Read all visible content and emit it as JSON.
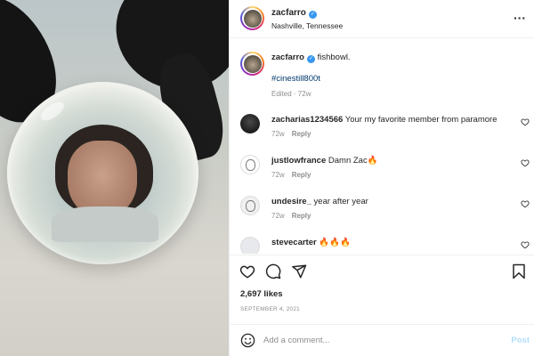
{
  "post": {
    "username": "zacfarro",
    "location": "Nashville, Tennessee",
    "more_icon": "more-horizontal-icon",
    "verified_icon": "verified-badge-icon"
  },
  "caption": {
    "username": "zacfarro",
    "text": "fishbowl.",
    "hashtag": "#cinestill800t",
    "meta": "Edited · 72w"
  },
  "comments": [
    {
      "username": "zacharias1234566",
      "text": "Your my favorite member from paramore",
      "age": "72w",
      "reply": "Reply"
    },
    {
      "username": "justlowfrance",
      "text": "Damn Zac🔥",
      "age": "72w",
      "reply": "Reply"
    },
    {
      "username": "undesire_",
      "text": "year after year",
      "age": "72w",
      "reply": "Reply"
    },
    {
      "username": "stevecarter",
      "text": "🔥🔥🔥",
      "age": "",
      "reply": ""
    }
  ],
  "actions": {
    "like_icon": "heart-icon",
    "comment_icon": "comment-icon",
    "share_icon": "paper-plane-icon",
    "save_icon": "bookmark-icon"
  },
  "likes": "2,697 likes",
  "date": "SEPTEMBER 4, 2021",
  "composer": {
    "placeholder": "Add a comment...",
    "post_label": "Post",
    "emoji_icon": "emoji-icon"
  },
  "colors": {
    "link": "#00376b",
    "verified": "#3897f0",
    "post_disabled": "#b2dffc",
    "muted": "#8e8e8e"
  }
}
